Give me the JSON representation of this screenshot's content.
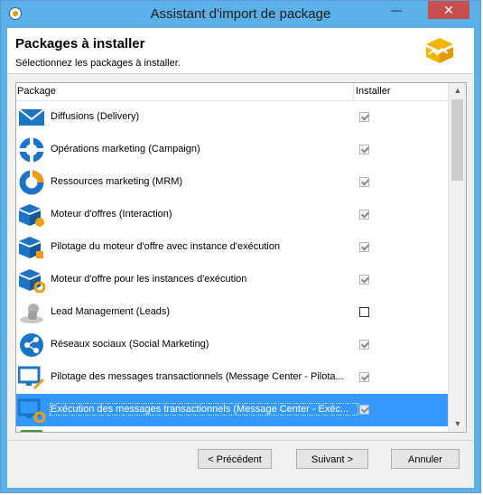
{
  "window": {
    "title": "Assistant d'import de package",
    "minimize_glyph": "—",
    "close_glyph": "✕"
  },
  "header": {
    "title": "Packages à installer",
    "subtitle": "Sélectionnez les packages à installer."
  },
  "grid": {
    "columns": [
      "Package",
      "Installer"
    ],
    "rows": [
      {
        "label": "Diffusions (Delivery)",
        "icon": "envelope-icon",
        "checked": true
      },
      {
        "label": "Opérations marketing (Campaign)",
        "icon": "campaign-ring-icon",
        "checked": true
      },
      {
        "label": "Ressources marketing (MRM)",
        "icon": "mrm-ring-icon",
        "checked": true
      },
      {
        "label": "Moteur d'offres (Interaction)",
        "icon": "offer-engine-icon",
        "checked": true
      },
      {
        "label": "Pilotage du moteur d'offre avec instance d'exécution",
        "icon": "offer-engine-control-icon",
        "checked": true
      },
      {
        "label": "Moteur d'offre pour les instances d'exécution",
        "icon": "offer-engine-execution-icon",
        "checked": true
      },
      {
        "label": "Lead Management (Leads)",
        "icon": "leads-icon",
        "checked": false
      },
      {
        "label": "Réseaux sociaux (Social Marketing)",
        "icon": "social-share-icon",
        "checked": true
      },
      {
        "label": "Pilotage des messages transactionnels (Message Center - Pilota...",
        "icon": "message-center-control-icon",
        "checked": true
      },
      {
        "label": "Exécution des messages transactionnels (Message Center - Exéc...",
        "icon": "message-center-execution-icon",
        "checked": true,
        "selected": true
      }
    ]
  },
  "scrollbar": {
    "up": "▲",
    "down": "▼"
  },
  "buttons": {
    "previous": "< Précédent",
    "next": "Suivant >",
    "cancel": "Annuler"
  },
  "colors": {
    "titlebar": "#5cb0e8",
    "selection": "#3399ff",
    "close": "#c7504f"
  }
}
